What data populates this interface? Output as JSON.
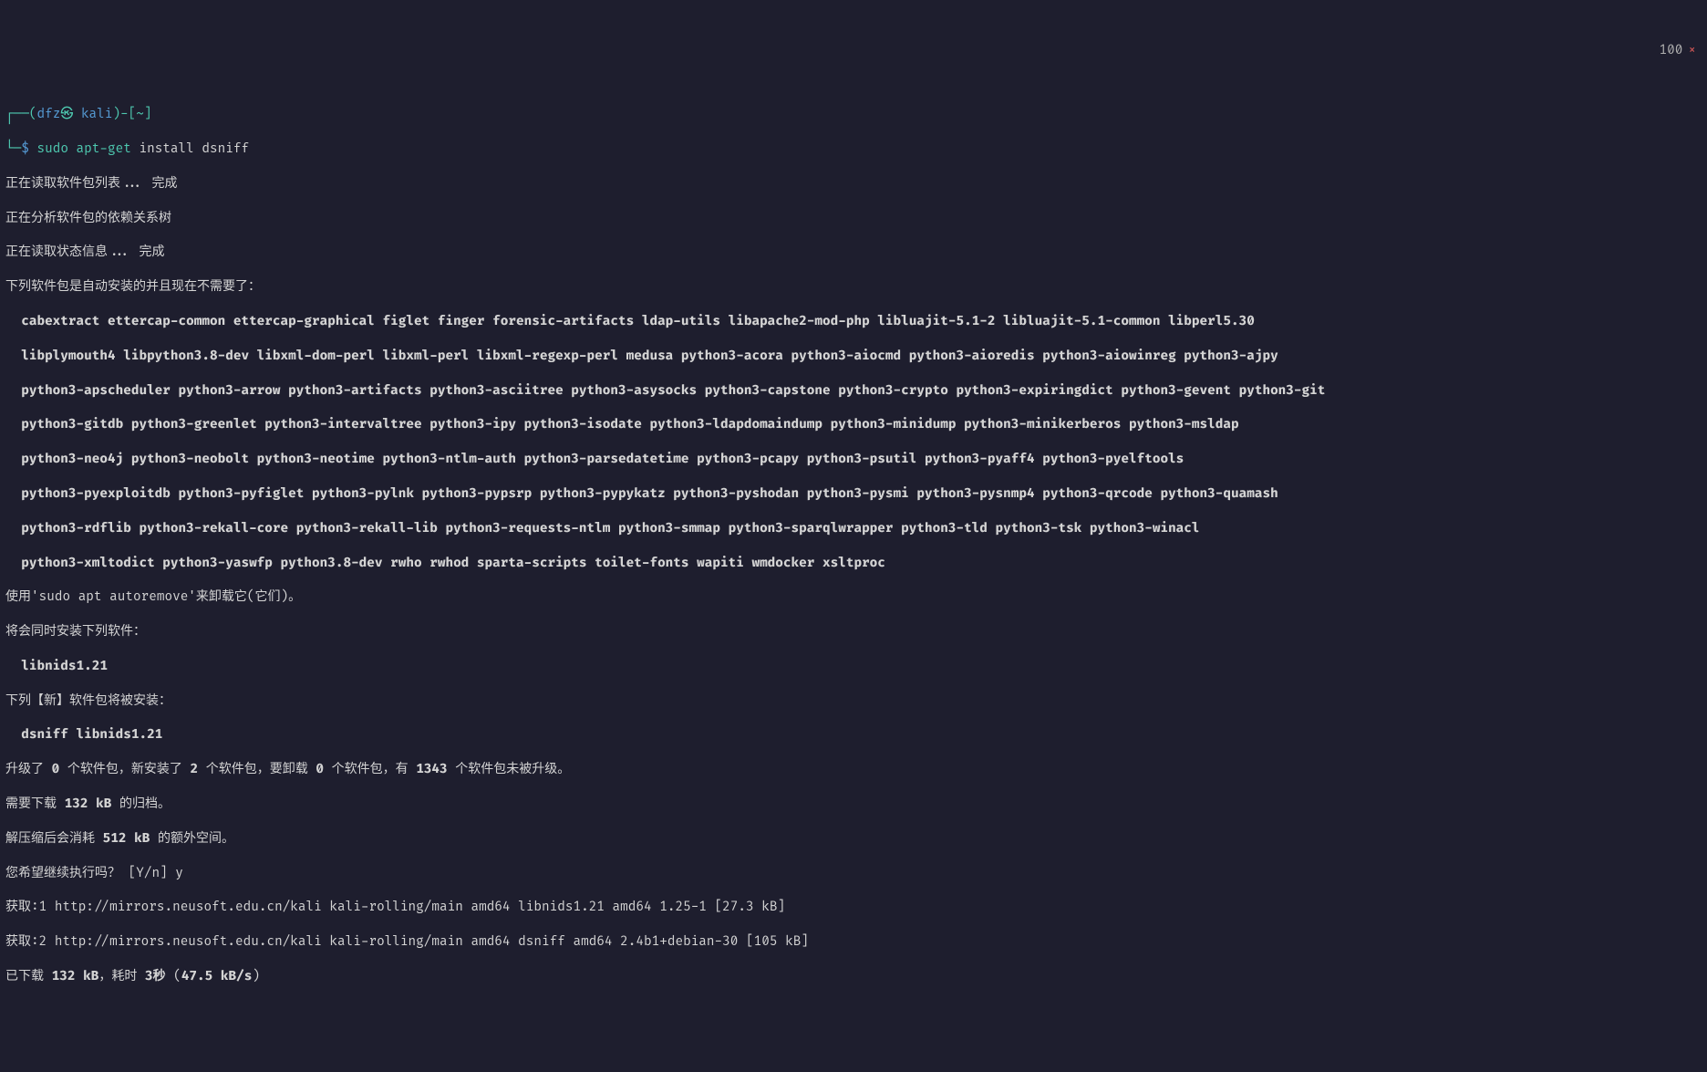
{
  "topRight": {
    "number": "100",
    "close": "×"
  },
  "prompt": {
    "line1_open": "┌──(",
    "user": "dfz",
    "at": "㉿",
    "host": " kali",
    "line1_close": ")-[",
    "path": "~",
    "line1_end": "]",
    "line2_open": "└─",
    "dollar": "$ ",
    "cmd_sudo": "sudo apt-get",
    "cmd_args": " install dsniff"
  },
  "output": {
    "reading_pkg_list": "正在读取软件包列表... 完成",
    "analyzing_deps": "正在分析软件包的依赖关系树",
    "reading_state": "正在读取状态信息... 完成",
    "auto_installed_header": "下列软件包是自动安装的并且现在不需要了：",
    "pkg_line1": "cabextract ettercap-common ettercap-graphical figlet finger forensic-artifacts ldap-utils libapache2-mod-php libluajit-5.1-2 libluajit-5.1-common libperl5.30",
    "pkg_line2": "libplymouth4 libpython3.8-dev libxml-dom-perl libxml-perl libxml-regexp-perl medusa python3-acora python3-aiocmd python3-aioredis python3-aiowinreg python3-ajpy",
    "pkg_line3": "python3-apscheduler python3-arrow python3-artifacts python3-asciitree python3-asysocks python3-capstone python3-crypto python3-expiringdict python3-gevent python3-git",
    "pkg_line4": "python3-gitdb python3-greenlet python3-intervaltree python3-ipy python3-isodate python3-ldapdomaindump python3-minidump python3-minikerberos python3-msldap",
    "pkg_line5": "python3-neo4j python3-neobolt python3-neotime python3-ntlm-auth python3-parsedatetime python3-pcapy python3-psutil python3-pyaff4 python3-pyelftools",
    "pkg_line6": "python3-pyexploitdb python3-pyfiglet python3-pylnk python3-pypsrp python3-pypykatz python3-pyshodan python3-pysmi python3-pysnmp4 python3-qrcode python3-quamash",
    "pkg_line7": "python3-rdflib python3-rekall-core python3-rekall-lib python3-requests-ntlm python3-smmap python3-sparqlwrapper python3-tld python3-tsk python3-winacl",
    "pkg_line8": "python3-xmltodict python3-yaswfp python3.8-dev rwho rwhod sparta-scripts toilet-fonts wapiti wmdocker xsltproc",
    "autoremove_hint": "使用'sudo apt autoremove'来卸载它(它们)。",
    "also_install_header": "将会同时安装下列软件：",
    "also_install_pkgs": "libnids1.21",
    "new_install_header": "下列【新】软件包将被安装：",
    "new_install_pkgs": "dsniff libnids1.21",
    "upgrade_summary_a": "升级了 ",
    "upgrade_summary_b": " 个软件包，新安装了 ",
    "upgrade_summary_c": " 个软件包，要卸载 ",
    "upgrade_summary_d": " 个软件包，有 ",
    "upgrade_summary_e": " 个软件包未被升级。",
    "count_upgraded": "0",
    "count_new": "2",
    "count_remove": "0",
    "count_notupgraded": "1343",
    "need_download_a": "需要下载 ",
    "need_download_b": " 的归档。",
    "download_size": "132 kB",
    "after_extract_a": "解压缩后会消耗 ",
    "after_extract_b": " 的额外空间。",
    "extract_size": "512 kB",
    "confirm_prompt": "您希望继续执行吗？ [Y/n] y",
    "get1": "获取:1 http://mirrors.neusoft.edu.cn/kali kali-rolling/main amd64 libnids1.21 amd64 1.25-1 [27.3 kB]",
    "get2": "获取:2 http://mirrors.neusoft.edu.cn/kali kali-rolling/main amd64 dsniff amd64 2.4b1+debian-30 [105 kB]",
    "downloaded_a": "已下载 ",
    "downloaded_b": "，耗时 ",
    "downloaded_c": " (",
    "downloaded_d": ")",
    "dl_size": "132 kB",
    "dl_time": "3秒",
    "dl_speed": "47.5 kB/s"
  }
}
